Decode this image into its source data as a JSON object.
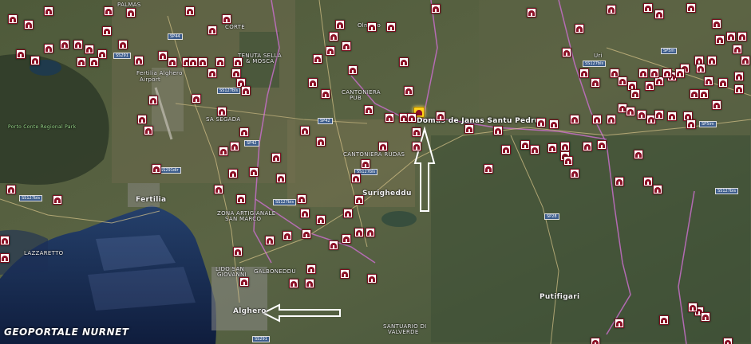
{
  "map": {
    "featured_site": {
      "label": "Domus de Janas Santu Pedru",
      "icon": "featured-site-icon"
    },
    "place_labels": {
      "alghero": "Alghero",
      "fertilia": "Fertilia",
      "airport": "Fertilia Alghero",
      "airport2": "Airport",
      "putifigari": "Putifigari",
      "olmedo": "Olmedo",
      "uri": "Uri",
      "surigheddu": "Surigheddu",
      "tenuta": "TENUTA SELLA",
      "tenuta2": "& MOSCA",
      "cantoniera_rudas": "CANTONIERA RUDAS",
      "cantoniera_pub": "CANTONIERA",
      "cantoniera_pub2": "PUB",
      "sa_segada": "SA SEGADA",
      "zona1": "ZONA ARTIGIANALE",
      "zona2": "SAN MARCO",
      "lazzaretto": "LAZZARETTO",
      "lido1": "LIDO SAN",
      "lido2": "GIOVANNI",
      "galboneddu": "GALBONEDDU",
      "santuario1": "SANTUARIO DI",
      "santuario2": "VALVERDE",
      "porto_conte": "Porto Conte Regional Park",
      "palmas": "PALMAS",
      "corte": "CORTE"
    },
    "road_labels": {
      "r1": "SS291",
      "r2": "SP44",
      "r3": "SS127bis",
      "r4": "SP42",
      "r5": "SP5im",
      "r6": "SS291dir",
      "r7": "SS127bis",
      "r8": "SS127bis",
      "r9": "SS127bis",
      "r10": "SP28",
      "r11": "SS127bis",
      "r12": "SP5m",
      "r13": "SS127bis",
      "r14": "SS291",
      "r15": "SP42"
    },
    "colors": {
      "site_marker": "#8c1026",
      "featured_marker": "#ffd21a",
      "boundary": "#c56fc8"
    },
    "site_icon": "archaeological-site-icon",
    "arrows": {
      "icon": "outline-arrow-icon"
    },
    "watermark": "GEOPORTALE NURNET"
  }
}
